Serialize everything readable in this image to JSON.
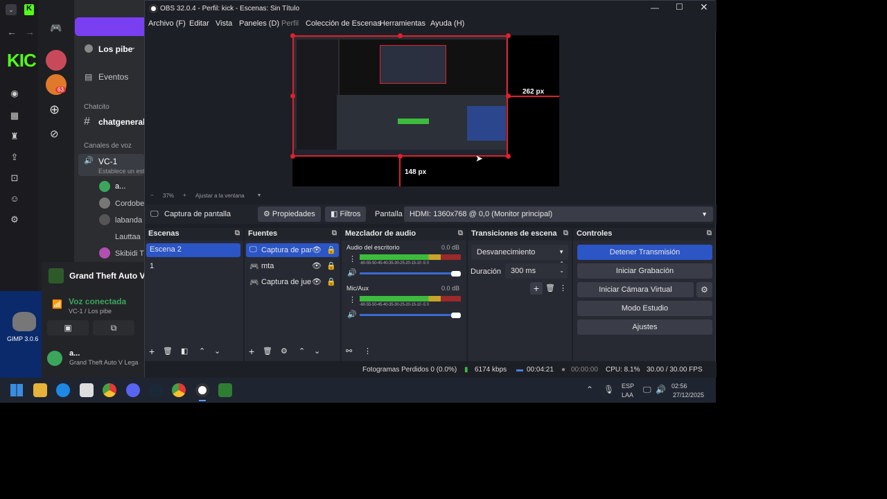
{
  "browser": {
    "kick_logo": "KIC"
  },
  "discord": {
    "server_name": "Los pibe",
    "events": "Eventos",
    "text_category": "Chatcito",
    "text_channel": "chatgeneral",
    "voice_category": "Canales de voz",
    "voice_channel": "VC-1",
    "voice_status": "Establece un est",
    "members": [
      "a...",
      "Cordobe",
      "labanda",
      "Lauttaa",
      "Skibidi T"
    ],
    "activity": "Grand Theft Auto V L",
    "voice_connected": "Voz conectada",
    "voice_location": "VC-1 / Los pibe",
    "user_name": "a...",
    "user_status": "Grand Theft Auto V Lega",
    "badge_count": "63"
  },
  "desktop": {
    "gimp_label": "GIMP 3.0.6"
  },
  "obs": {
    "title": "OBS 32.0.4 - Perfil: kick - Escenas: Sin Título",
    "menu": [
      "Archivo (F)",
      "Editar",
      "Vista",
      "Paneles (D)",
      "Perfil",
      "Colección de Escenas",
      "Herramientas",
      "Ayuda (H)"
    ],
    "size_right": "262 px",
    "size_bottom": "148 px",
    "zoom": "37%",
    "fit_label": "Ajustar a la ventana",
    "source_name": "Captura de pantalla",
    "properties": "Propiedades",
    "filters": "Filtros",
    "display_label": "Pantalla",
    "display_value": "HDMI: 1360x768 @ 0,0 (Monitor principal)",
    "docks": {
      "scenes": {
        "title": "Escenas",
        "items": [
          "Escena 2",
          "1"
        ]
      },
      "sources": {
        "title": "Fuentes",
        "items": [
          "Captura de par",
          "mta",
          "Captura de jue"
        ]
      },
      "mixer": {
        "title": "Mezclador de audio",
        "channels": [
          {
            "name": "Audio del escritorio",
            "db": "0.0 dB",
            "level": 0.9
          },
          {
            "name": "Mic/Aux",
            "db": "0.0 dB",
            "level": 0.8
          }
        ],
        "scale": "-60-55-50-45-40-35-30-25-20-15-10 -5 0"
      },
      "transitions": {
        "title": "Transiciones de escena",
        "type": "Desvanecimiento",
        "duration_label": "Duración",
        "duration_value": "300 ms"
      },
      "controls": {
        "title": "Controles",
        "buttons": [
          "Detener Transmisión",
          "Iniciar Grabación",
          "Iniciar Cámara Virtual",
          "Modo Estudio",
          "Ajustes"
        ]
      }
    },
    "status": {
      "dropped": "Fotogramas Perdidos 0 (0.0%)",
      "bitrate": "6174 kbps",
      "stream_time": "00:04:21",
      "rec_time": "00:00:00",
      "cpu": "CPU: 8.1%",
      "fps": "30.00 / 30.00 FPS"
    }
  },
  "taskbar": {
    "lang": "ESP",
    "lang2": "LAA",
    "time": "02:56",
    "date": "27/12/2025"
  }
}
